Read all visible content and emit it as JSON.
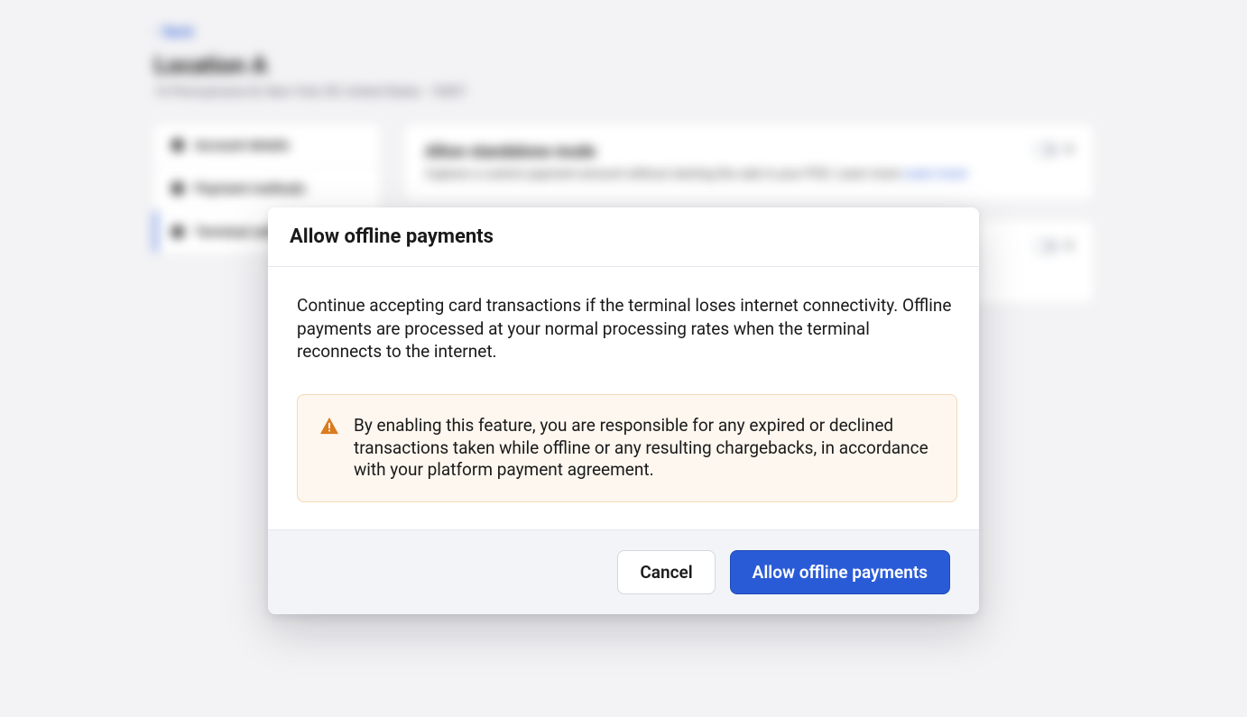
{
  "background": {
    "back_label": "Back",
    "location_title": "Location A",
    "location_address": "16 Pennsylvania St, New York, NY, United States · 10007",
    "sidebar": {
      "items": [
        {
          "label": "Account details"
        },
        {
          "label": "Payment methods"
        },
        {
          "label": "Terminal settings"
        }
      ]
    },
    "cards": [
      {
        "title": "Allow standalone mode",
        "desc": "Capture a custom payment amount without starting the sale in your POS. Learn more ",
        "learn_more": "Learn more",
        "toggle_off": "0"
      },
      {
        "title": "",
        "desc": "",
        "toggle_off": "0"
      }
    ]
  },
  "modal": {
    "title": "Allow offline payments",
    "description": "Continue accepting card transactions if the terminal loses internet connectivity. Offline payments are processed at your normal processing rates when the terminal reconnects to the internet.",
    "alert_text": "By enabling this feature, you are responsible for any expired or declined transactions taken while offline or any resulting chargebacks, in accordance with your platform payment agreement.",
    "cancel_label": "Cancel",
    "confirm_label": "Allow offline payments"
  }
}
